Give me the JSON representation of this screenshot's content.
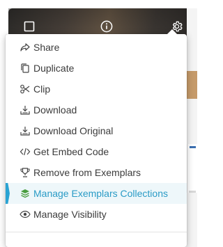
{
  "colors": {
    "text": "#3b3b3b",
    "accent": "#2a9bc6",
    "active_bg": "#eef7fa",
    "icon_green": "#4a9d3f"
  },
  "toolbar": {
    "icons": [
      "checkbox-icon",
      "info-icon",
      "gear-icon"
    ]
  },
  "menu": {
    "items": [
      {
        "label": "Share",
        "icon": "share-icon"
      },
      {
        "label": "Duplicate",
        "icon": "duplicate-icon"
      },
      {
        "label": "Clip",
        "icon": "scissors-icon"
      },
      {
        "label": "Download",
        "icon": "download-icon"
      },
      {
        "label": "Download Original",
        "icon": "download-icon"
      },
      {
        "label": "Get Embed Code",
        "icon": "code-icon"
      },
      {
        "label": "Remove from Exemplars",
        "icon": "trophy-icon"
      },
      {
        "label": "Manage Exemplars Collections",
        "icon": "stack-icon",
        "active": true
      },
      {
        "label": "Manage Visibility",
        "icon": "eye-icon"
      }
    ]
  }
}
